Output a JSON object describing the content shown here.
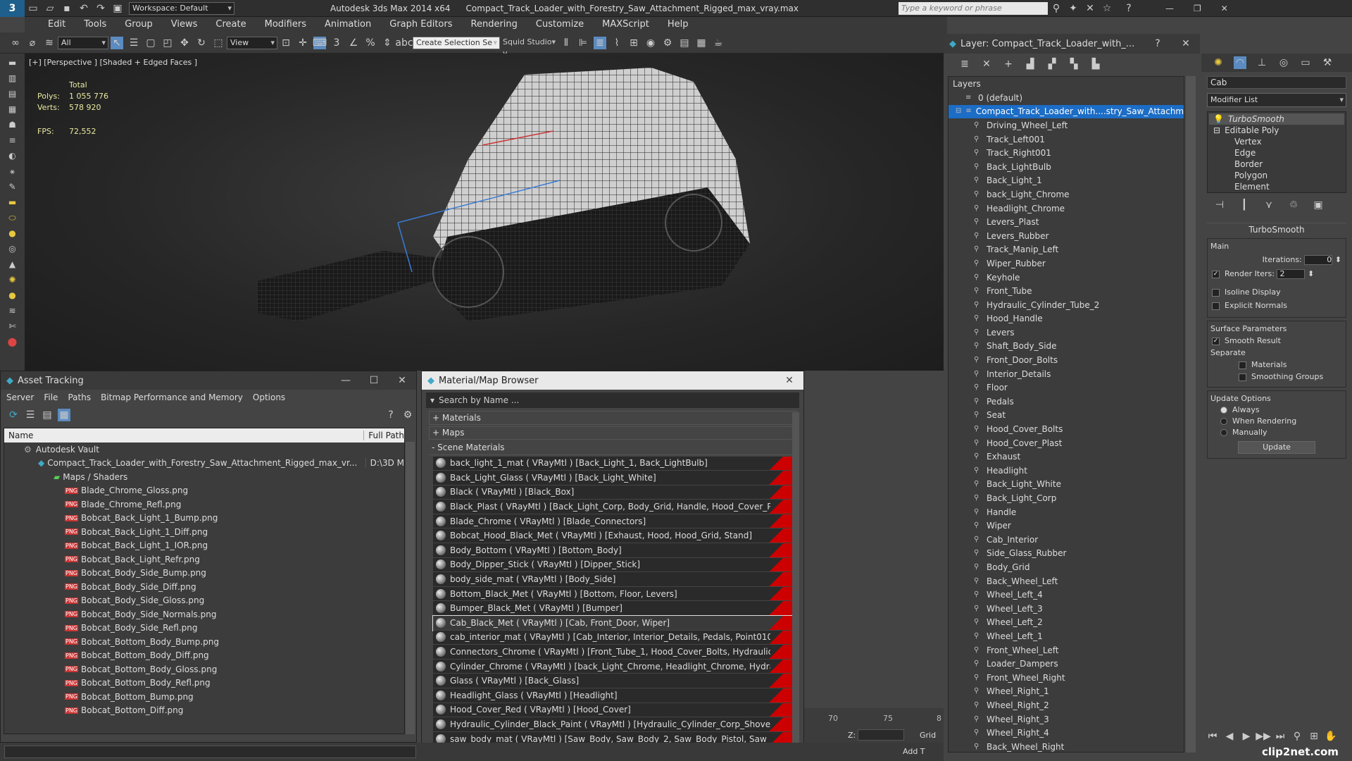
{
  "titlebar": {
    "workspace": "Workspace: Default",
    "app": "Autodesk 3ds Max  2014 x64",
    "file": "Compact_Track_Loader_with_Forestry_Saw_Attachment_Rigged_max_vray.max",
    "search_placeholder": "Type a keyword or phrase"
  },
  "menu": [
    "Edit",
    "Tools",
    "Group",
    "Views",
    "Create",
    "Modifiers",
    "Animation",
    "Graph Editors",
    "Rendering",
    "Customize",
    "MAXScript",
    "Help"
  ],
  "toolbar": {
    "filter": "All",
    "view": "View",
    "selset": "Create Selection Se",
    "squid": "Squid Studio v"
  },
  "viewport": {
    "label": "[+] [Perspective ] [Shaded + Edged Faces ]",
    "total": "Total",
    "polys_label": "Polys:",
    "polys": "1 055 776",
    "verts_label": "Verts:",
    "verts": "578 920",
    "fps_label": "FPS:",
    "fps": "72,552"
  },
  "asset": {
    "title": "Asset Tracking",
    "menu": [
      "Server",
      "File",
      "Paths",
      "Bitmap Performance and Memory",
      "Options"
    ],
    "col_name": "Name",
    "col_path": "Full Path",
    "vault": "Autodesk Vault",
    "file": "Compact_Track_Loader_with_Forestry_Saw_Attachment_Rigged_max_vr...",
    "file_path": "D:\\3D M",
    "maps": "Maps / Shaders",
    "items": [
      "Blade_Chrome_Gloss.png",
      "Blade_Chrome_Refl.png",
      "Bobcat_Back_Light_1_Bump.png",
      "Bobcat_Back_Light_1_Diff.png",
      "Bobcat_Back_Light_1_IOR.png",
      "Bobcat_Back_Light_Refr.png",
      "Bobcat_Body_Side_Bump.png",
      "Bobcat_Body_Side_Diff.png",
      "Bobcat_Body_Side_Gloss.png",
      "Bobcat_Body_Side_Normals.png",
      "Bobcat_Body_Side_Refl.png",
      "Bobcat_Bottom_Body_Bump.png",
      "Bobcat_Bottom_Body_Diff.png",
      "Bobcat_Bottom_Body_Gloss.png",
      "Bobcat_Bottom_Body_Refl.png",
      "Bobcat_Bottom_Bump.png",
      "Bobcat_Bottom_Diff.png"
    ]
  },
  "mat": {
    "title": "Material/Map Browser",
    "search": "Search by Name ...",
    "materials": "+ Materials",
    "maps": "+ Maps",
    "scene": "- Scene Materials",
    "items": [
      "back_light_1_mat  ( VRayMtl ) [Back_Light_1, Back_LightBulb]",
      "Back_Light_Glass  ( VRayMtl ) [Back_Light_White]",
      "Black  ( VRayMtl ) [Black_Box]",
      "Black_Plast  ( VRayMtl ) [Back_Light_Corp, Body_Grid, Handle, Hood_Cover_Pla...",
      "Blade_Chrome  ( VRayMtl ) [Blade_Connectors]",
      "Bobcat_Hood_Black_Met  ( VRayMtl ) [Exhaust, Hood, Hood_Grid, Stand]",
      "Body_Bottom  ( VRayMtl ) [Bottom_Body]",
      "Body_Dipper_Stick  ( VRayMtl ) [Dipper_Stick]",
      "body_side_mat  ( VRayMtl ) [Body_Side]",
      "Bottom_Black_Met  ( VRayMtl ) [Bottom, Floor, Levers]",
      "Bumper_Black_Met  ( VRayMtl ) [Bumper]",
      "Cab_Black_Met  ( VRayMtl ) [Cab, Front_Door, Wiper]",
      "cab_interior_mat  ( VRayMtl ) [Cab_Interior, Interior_Details, Pedals, Point010,...",
      "Connectors_Chrome  ( VRayMtl ) [Front_Tube_1, Hood_Cover_Bolts, Hydraulic_...",
      "Cylinder_Chrome  ( VRayMtl ) [back_Light_Chrome, Headlight_Chrome, Hydrauli...",
      "Glass  ( VRayMtl ) [Back_Glass]",
      "Headlight_Glass  ( VRayMtl ) [Headlight]",
      "Hood_Cover_Red  ( VRayMtl ) [Hood_Cover]",
      "Hydraulic_Cylinder_Black_Paint  ( VRayMtl ) [Hydraulic_Cylinder_Corp_Shovel, H...",
      "saw_body_mat  ( VRayMtl ) [Saw_Body, Saw_Body_2, Saw_Body_Pistol, Saw_B..."
    ]
  },
  "layer": {
    "title": "Layer: Compact_Track_Loader_with_...",
    "header": "Layers",
    "default": "0 (default)",
    "root": "Compact_Track_Loader_with....stry_Saw_Attachment",
    "items": [
      "Driving_Wheel_Left",
      "Track_Left001",
      "Track_Right001",
      "Back_LightBulb",
      "Back_Light_1",
      "back_Light_Chrome",
      "Headlight_Chrome",
      "Levers_Plast",
      "Levers_Rubber",
      "Track_Manip_Left",
      "Wiper_Rubber",
      "Keyhole",
      "Front_Tube",
      "Hydraulic_Cylinder_Tube_2",
      "Hood_Handle",
      "Levers",
      "Shaft_Body_Side",
      "Front_Door_Bolts",
      "Interior_Details",
      "Floor",
      "Pedals",
      "Seat",
      "Hood_Cover_Bolts",
      "Hood_Cover_Plast",
      "Exhaust",
      "Headlight",
      "Back_Light_White",
      "Back_Light_Corp",
      "Handle",
      "Wiper",
      "Cab_Interior",
      "Side_Glass_Rubber",
      "Body_Grid",
      "Back_Wheel_Left",
      "Wheel_Left_4",
      "Wheel_Left_3",
      "Wheel_Left_2",
      "Wheel_Left_1",
      "Front_Wheel_Left",
      "Loader_Dampers",
      "Front_Wheel_Right",
      "Wheel_Right_1",
      "Wheel_Right_2",
      "Wheel_Right_3",
      "Wheel_Right_4",
      "Back_Wheel_Right"
    ]
  },
  "cmd": {
    "name": "Cab",
    "modlist": "Modifier List",
    "stack": [
      "TurboSmooth",
      "Editable Poly",
      "Vertex",
      "Edge",
      "Border",
      "Polygon",
      "Element"
    ],
    "ts_title": "TurboSmooth",
    "main": "Main",
    "iter_label": "Iterations:",
    "iter": "0",
    "render_label": "Render Iters:",
    "render": "2",
    "isoline": "Isoline Display",
    "explicit": "Explicit Normals",
    "surface": "Surface Parameters",
    "smooth": "Smooth Result",
    "separate": "Separate",
    "materials": "Materials",
    "smoothing": "Smoothing Groups",
    "update_opts": "Update Options",
    "always": "Always",
    "when": "When Rendering",
    "manually": "Manually",
    "update": "Update"
  },
  "timeline": {
    "t70": "70",
    "t75": "75",
    "t80": "8",
    "z": "Z:",
    "grid": "Grid =",
    "add": "Add T"
  },
  "watermark": "clip2net.com"
}
